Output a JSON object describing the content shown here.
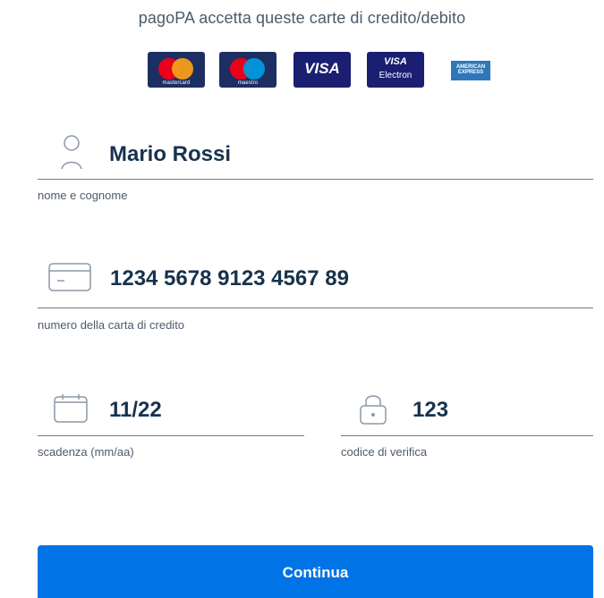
{
  "intro_text": "pagoPA accetta queste carte di credito/debito",
  "card_logos": [
    {
      "name": "mastercard",
      "label": "mastercard"
    },
    {
      "name": "maestro",
      "label": "maestro"
    },
    {
      "name": "visa",
      "label": "VISA"
    },
    {
      "name": "visa-electron",
      "label": "VISA",
      "sublabel": "Electron"
    },
    {
      "name": "american-express",
      "label": "AMERICAN EXPRESS"
    }
  ],
  "fields": {
    "name": {
      "value": "Mario Rossi",
      "label": "nome e cognome",
      "icon": "user-icon"
    },
    "card_number": {
      "value": "1234 5678 9123 4567 89",
      "label": "numero della carta di credito",
      "icon": "credit-card-icon"
    },
    "expiry": {
      "value": "11/22",
      "label": "scadenza (mm/aa)",
      "icon": "calendar-icon"
    },
    "cvv": {
      "value": "123",
      "label": "codice di verifica",
      "icon": "lock-icon"
    }
  },
  "buttons": {
    "continue": "Continua"
  },
  "colors": {
    "primary": "#0073e6",
    "text": "#17324d",
    "muted": "#4b5a6a",
    "line": "#6b7b8b"
  }
}
